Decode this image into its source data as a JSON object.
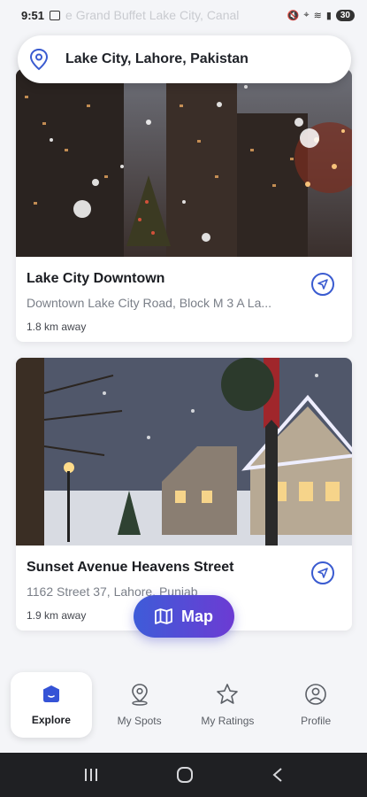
{
  "status_bar": {
    "time": "9:51",
    "notification_text": "e Grand Buffet Lake City, Canal",
    "battery": "30"
  },
  "location": {
    "text": "Lake City, Lahore, Pakistan"
  },
  "places": [
    {
      "title": "Lake City Downtown",
      "address": "Downtown Lake City Road, Block M 3 A La...",
      "distance": "1.8 km away"
    },
    {
      "title": "Sunset Avenue Heavens Street",
      "address": "1162 Street 37, Lahore, Punjab",
      "distance": "1.9 km away"
    }
  ],
  "map_button": {
    "label": "Map"
  },
  "bottom_nav": {
    "tabs": [
      {
        "label": "Explore",
        "icon": "explore-icon",
        "active": true
      },
      {
        "label": "My Spots",
        "icon": "location-pin-icon"
      },
      {
        "label": "My Ratings",
        "icon": "star-icon"
      },
      {
        "label": "Profile",
        "icon": "profile-icon"
      }
    ]
  },
  "colors": {
    "accent": "#3a5bd0",
    "gradient_start": "#3e5cd8",
    "gradient_end": "#6c3bd3",
    "system_nav": "#1f2023"
  }
}
